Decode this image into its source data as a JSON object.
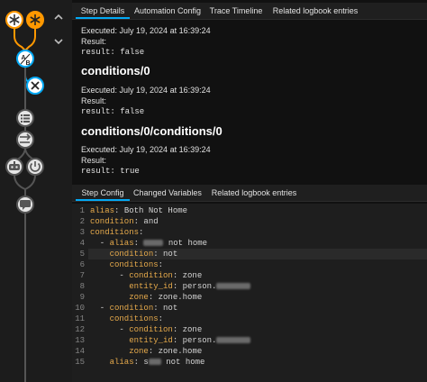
{
  "colors": {
    "accent": "#03a9f4",
    "trigger_node": "#ff9800",
    "condition_node": "#03a9f4",
    "yaml_key": "#e5a94b"
  },
  "graph": {
    "nodes": [
      {
        "name": "trigger-node-1",
        "icon": "asterisk-icon"
      },
      {
        "name": "trigger-node-2",
        "icon": "asterisk-icon"
      },
      {
        "name": "condition-node",
        "icon": "ab-condition-icon"
      },
      {
        "name": "condition-failed-node",
        "icon": "close-icon"
      },
      {
        "name": "action-node-1",
        "icon": "list-icon"
      },
      {
        "name": "action-node-2",
        "icon": "arrow-right-icon"
      },
      {
        "name": "action-node-3",
        "icon": "robot-icon"
      },
      {
        "name": "action-node-4",
        "icon": "power-icon"
      },
      {
        "name": "action-node-5",
        "icon": "message-icon"
      }
    ]
  },
  "top_tabs": [
    "Step Details",
    "Automation Config",
    "Trace Timeline",
    "Related logbook entries"
  ],
  "step_details": {
    "blocks": [
      {
        "executed": "Executed: July 19, 2024 at 16:39:24",
        "result_label": "Result:",
        "result_value": "result: false"
      },
      {
        "heading": "conditions/0",
        "executed": "Executed: July 19, 2024 at 16:39:24",
        "result_label": "Result:",
        "result_value": "result: false"
      },
      {
        "heading": "conditions/0/conditions/0",
        "executed": "Executed: July 19, 2024 at 16:39:24",
        "result_label": "Result:",
        "result_value": "result: true"
      }
    ]
  },
  "bottom_tabs": [
    "Step Config",
    "Changed Variables",
    "Related logbook entries"
  ],
  "editor": {
    "line_numbers": [
      "1",
      "2",
      "3",
      "4",
      "5",
      "6",
      "7",
      "8",
      "9",
      "10",
      "11",
      "12",
      "13",
      "14",
      "15"
    ],
    "lines": [
      {
        "indent": "",
        "key": "alias",
        "value": " Both Not Home"
      },
      {
        "indent": "",
        "key": "condition",
        "value": " and"
      },
      {
        "indent": "",
        "key": "conditions",
        "value": ""
      },
      {
        "indent": "  - ",
        "key": "alias",
        "value": " ",
        "tail": " not home"
      },
      {
        "indent": "    ",
        "key": "condition",
        "value": " not"
      },
      {
        "indent": "    ",
        "key": "conditions",
        "value": ""
      },
      {
        "indent": "      - ",
        "key": "condition",
        "value": " zone"
      },
      {
        "indent": "        ",
        "key": "entity_id",
        "value": " person.",
        "tail": ""
      },
      {
        "indent": "        ",
        "key": "zone",
        "value": " zone.home"
      },
      {
        "indent": "  - ",
        "key": "condition",
        "value": " not"
      },
      {
        "indent": "    ",
        "key": "conditions",
        "value": ""
      },
      {
        "indent": "      - ",
        "key": "condition",
        "value": " zone"
      },
      {
        "indent": "        ",
        "key": "entity_id",
        "value": " person.",
        "tail": ""
      },
      {
        "indent": "        ",
        "key": "zone",
        "value": " zone.home"
      },
      {
        "indent": "    ",
        "key": "alias",
        "value": " s",
        "tail": " not home"
      }
    ]
  }
}
